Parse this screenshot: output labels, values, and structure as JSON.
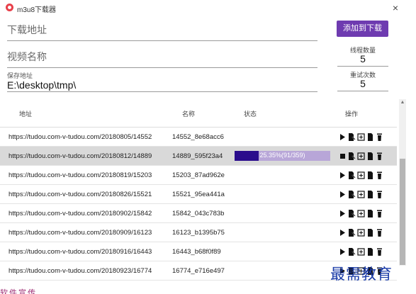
{
  "window": {
    "title": "m3u8下载器",
    "close_glyph": "×"
  },
  "form": {
    "url_placeholder": "下载地址",
    "name_placeholder": "视频名称",
    "save_label": "保存地址",
    "save_value": "E:\\desktop\\tmp\\",
    "add_button": "添加到下载",
    "threads_label": "线程数量",
    "threads_value": "5",
    "retries_label": "重试次数",
    "retries_value": "5"
  },
  "table": {
    "headers": {
      "url": "地址",
      "name": "名称",
      "status": "状态",
      "ops": "操作"
    },
    "rows": [
      {
        "url": "https://tudou.com-v-tudou.com/20180805/14552",
        "name": "14552_8e68acc6",
        "status": "",
        "running": false
      },
      {
        "url": "https://tudou.com-v-tudou.com/20180812/14889",
        "name": "14889_595f23a4",
        "status": "25.35%(91/359)",
        "progress": 0.2535,
        "running": true,
        "selected": true
      },
      {
        "url": "https://tudou.com-v-tudou.com/20180819/15203",
        "name": "15203_87ad962e",
        "status": "",
        "running": false
      },
      {
        "url": "https://tudou.com-v-tudou.com/20180826/15521",
        "name": "15521_95ea441a",
        "status": "",
        "running": false
      },
      {
        "url": "https://tudou.com-v-tudou.com/20180902/15842",
        "name": "15842_043c783b",
        "status": "",
        "running": false
      },
      {
        "url": "https://tudou.com-v-tudou.com/20180909/16123",
        "name": "16123_b1395b75",
        "status": "",
        "running": false
      },
      {
        "url": "https://tudou.com-v-tudou.com/20180916/16443",
        "name": "16443_b68f0f89",
        "status": "",
        "running": false
      },
      {
        "url": "https://tudou.com-v-tudou.com/20180923/16774",
        "name": "16774_e716e497",
        "status": "",
        "running": false
      }
    ],
    "op_icons": [
      "play-icon",
      "edit-document-icon",
      "merge-icon",
      "file-icon",
      "delete-icon"
    ]
  },
  "colors": {
    "accent": "#6e3bb0",
    "progress_fill": "#2a0c8c",
    "progress_track": "#b8a6d8",
    "selected_row": "#d9d9d9"
  },
  "watermark": "最需教育",
  "cut_text": "软件宣传"
}
